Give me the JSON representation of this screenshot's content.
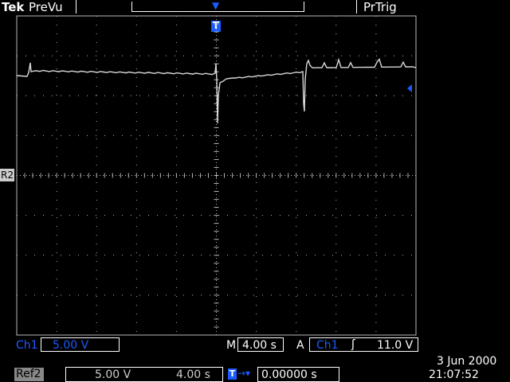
{
  "header": {
    "brand": "Tek",
    "mode": "PreVu",
    "trigger_status": "PrTrig"
  },
  "markers": {
    "trigger_position_marker": "T",
    "ref_marker": "R2"
  },
  "status": {
    "ch1_label": "Ch1",
    "ch1_scale": "5.00 V",
    "timebase_label": "M",
    "timebase": "4.00 s",
    "trigger_label": "A",
    "trigger_source": "Ch1",
    "trigger_level": "11.0 V",
    "ref_label": "Ref2",
    "ref_scale": "5.00 V",
    "ref_time": "4.00 s",
    "trigger_offset": "0.00000 s",
    "date": "3 Jun  2000",
    "time": "21:07:52"
  },
  "colors": {
    "trace": "#d8d8d8",
    "grid": "#b8b8b8",
    "accent_blue": "#1a5cff"
  }
}
